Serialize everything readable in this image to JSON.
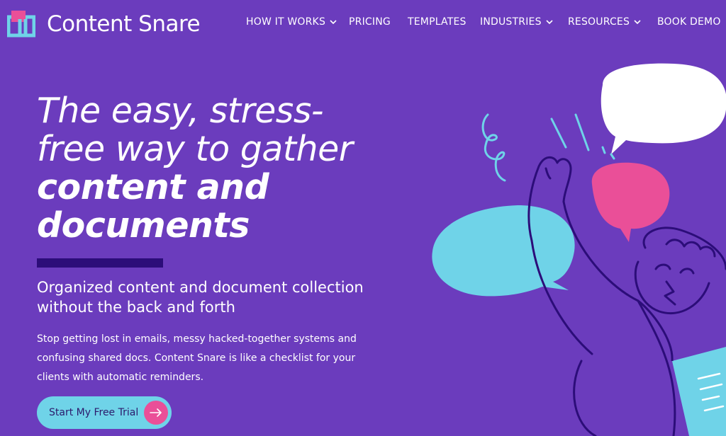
{
  "brand": {
    "name": "Content Snare",
    "colors": {
      "background": "#6b3cbd",
      "accent_pink": "#ea4f98",
      "accent_cyan": "#6fd3e8",
      "dark_purple": "#2c0d79"
    }
  },
  "nav": {
    "items": [
      {
        "label": "HOW IT WORKS",
        "has_dropdown": true
      },
      {
        "label": "PRICING",
        "has_dropdown": false
      },
      {
        "label": "TEMPLATES",
        "has_dropdown": false
      },
      {
        "label": "INDUSTRIES",
        "has_dropdown": true
      },
      {
        "label": "RESOURCES",
        "has_dropdown": true
      },
      {
        "label": "BOOK DEMO",
        "has_dropdown": false
      }
    ]
  },
  "hero": {
    "headline_line1": "The easy, stress-",
    "headline_line2": "free way to gather",
    "headline_line3": "content and",
    "headline_line4": "documents",
    "subhead_line1": "Organized content and document collection",
    "subhead_line2": "without the back and forth",
    "body_line1": "Stop getting lost in emails, messy hacked-together systems and",
    "body_line2": "confusing shared docs. Content Snare is like a checklist for your",
    "body_line3": "clients with automatic reminders.",
    "cta_label": "Start My Free Trial",
    "cta_icon": "arrow-right-icon"
  },
  "illustration": {
    "icons": [
      "speech-bubble-white-icon",
      "speech-bubble-pink-icon",
      "speech-bubble-cyan-icon",
      "character-high-five-icon",
      "document-icon"
    ]
  }
}
